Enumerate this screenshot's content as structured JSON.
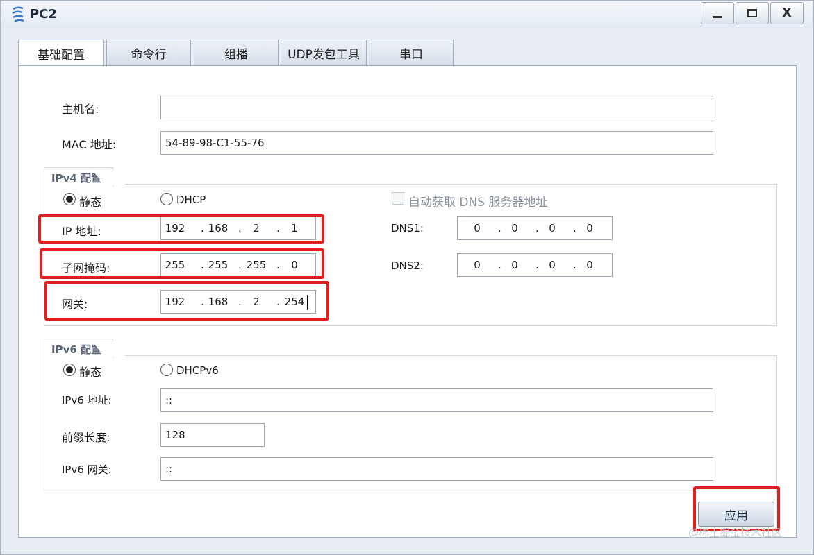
{
  "window": {
    "title": "PC2",
    "icon": "pc-terminal-icon"
  },
  "tabs": [
    {
      "label": "基础配置",
      "active": true
    },
    {
      "label": "命令行",
      "active": false
    },
    {
      "label": "组播",
      "active": false
    },
    {
      "label": "UDP发包工具",
      "active": false
    },
    {
      "label": "串口",
      "active": false
    }
  ],
  "host": {
    "hostname_label": "主机名:",
    "hostname_value": "",
    "mac_label": "MAC 地址:",
    "mac_value": "54-89-98-C1-55-76"
  },
  "ipv4": {
    "group_title": "IPv4 配置",
    "static_label": "静态",
    "dhcp_label": "DHCP",
    "mode": "static",
    "auto_dns_label": "自动获取 DNS 服务器地址",
    "auto_dns_checked": false,
    "ip_label": "IP 地址:",
    "ip": [
      "192",
      "168",
      "2",
      "1"
    ],
    "mask_label": "子网掩码:",
    "mask": [
      "255",
      "255",
      "255",
      "0"
    ],
    "gateway_label": "网关:",
    "gateway": [
      "192",
      "168",
      "2",
      "254"
    ],
    "dns1_label": "DNS1:",
    "dns1": [
      "0",
      "0",
      "0",
      "0"
    ],
    "dns2_label": "DNS2:",
    "dns2": [
      "0",
      "0",
      "0",
      "0"
    ]
  },
  "ipv6": {
    "group_title": "IPv6 配置",
    "static_label": "静态",
    "dhcp_label": "DHCPv6",
    "mode": "static",
    "address_label": "IPv6 地址:",
    "address_value": "::",
    "prefix_label": "前缀长度:",
    "prefix_value": "128",
    "gateway_label": "IPv6 网关:",
    "gateway_value": "::"
  },
  "actions": {
    "apply_label": "应用"
  },
  "watermark": "@稀土掘金技术社区",
  "colors": {
    "highlight": "#e21e1e",
    "window_bg": "#e9eef5"
  }
}
